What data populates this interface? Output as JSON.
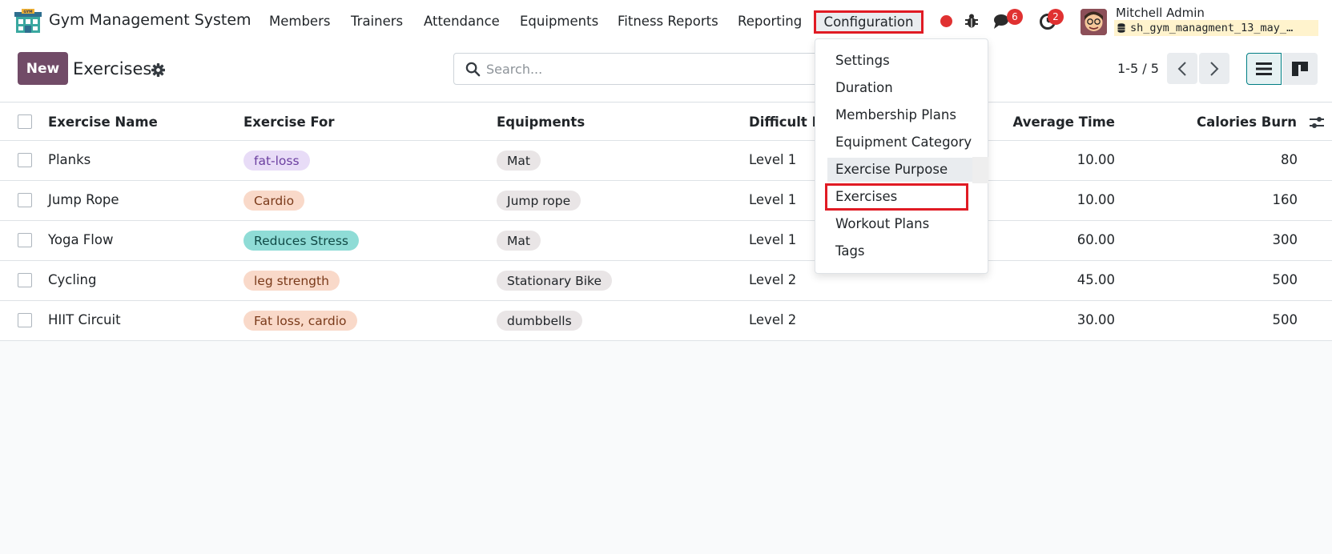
{
  "navbar": {
    "app_name": "Gym Management System",
    "menu": [
      "Members",
      "Trainers",
      "Attendance",
      "Equipments",
      "Fitness Reports",
      "Reporting"
    ],
    "config_label": "Configuration",
    "chat_count": "6",
    "activity_count": "2",
    "user_name": "Mitchell Admin",
    "db_name": "sh_gym_managment_13_may_…"
  },
  "control": {
    "new_label": "New",
    "title": "Exercises",
    "search_placeholder": "Search...",
    "pager": "1-5 / 5"
  },
  "table": {
    "headers": {
      "name": "Exercise Name",
      "for": "Exercise For",
      "equipments": "Equipments",
      "difficulty": "Difficult L",
      "avg_time": "Average Time",
      "calories": "Calories Burn"
    },
    "rows": [
      {
        "name": "Planks",
        "for": "fat-loss",
        "for_color": "#e8dcf7",
        "for_text": "#6b3fa0",
        "equipment": "Mat",
        "level": "Level 1",
        "time": "10.00",
        "calories": "80"
      },
      {
        "name": "Jump Rope",
        "for": "Cardio",
        "for_color": "#f9d9c9",
        "for_text": "#7a3a1a",
        "equipment": "Jump rope",
        "level": "Level 1",
        "time": "10.00",
        "calories": "160"
      },
      {
        "name": "Yoga Flow",
        "for": "Reduces Stress",
        "for_color": "#8fdcd6",
        "for_text": "#114a46",
        "equipment": "Mat",
        "level": "Level 1",
        "time": "60.00",
        "calories": "300"
      },
      {
        "name": "Cycling",
        "for": "leg strength",
        "for_color": "#f9d9c9",
        "for_text": "#7a3a1a",
        "equipment": "Stationary Bike",
        "level": "Level 2",
        "time": "45.00",
        "calories": "500"
      },
      {
        "name": "HIIT Circuit",
        "for": "Fat loss, cardio",
        "for_color": "#f9d9c9",
        "for_text": "#7a3a1a",
        "equipment": "dumbbells",
        "level": "Level 2",
        "time": "30.00",
        "calories": "500"
      }
    ]
  },
  "dropdown": {
    "items": [
      "Settings",
      "Duration",
      "Membership Plans",
      "Equipment Category",
      "Exercise Purpose",
      "Exercises",
      "Workout Plans",
      "Tags"
    ]
  },
  "colors": {
    "brand": "#714b67",
    "highlight_box": "#e01b24",
    "badge": "#e03131"
  }
}
